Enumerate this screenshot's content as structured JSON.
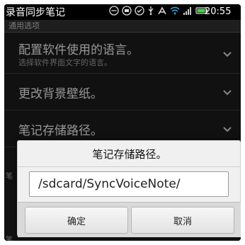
{
  "status_bar": {
    "app_title": "录音同步笔记",
    "time": "20:55",
    "icons": [
      "voicemail-icon",
      "message-icon",
      "check-circle-icon",
      "usb-icon",
      "debug-icon",
      "wifi-icon",
      "signal-icon",
      "battery-icon"
    ]
  },
  "settings": {
    "section_header": "通用选项",
    "items": [
      {
        "title": "配置软件使用的语言。",
        "summary": "选择软件界面文字的语言。"
      },
      {
        "title": "更改背景壁纸。",
        "summary": ""
      },
      {
        "title": "笔记存储路径。",
        "summary": ""
      }
    ],
    "side_fragment_1": "笔",
    "side_fragment_2": "笔"
  },
  "dialog": {
    "title": "笔记存储路径。",
    "input_value": "/sdcard/SyncVoiceNote/",
    "ok_label": "确定",
    "cancel_label": "取消"
  },
  "colors": {
    "background": "#1b1b1b",
    "status_bar": "#000000",
    "dialog_bg": "#f0f0f0",
    "text_primary": "#e6e6e6",
    "text_secondary": "#9a9a9a"
  }
}
